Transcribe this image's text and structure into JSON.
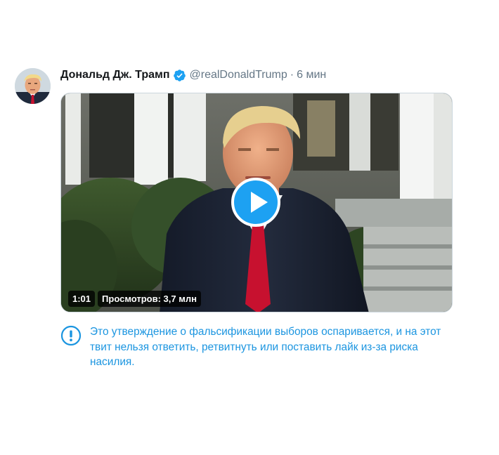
{
  "tweet": {
    "author_name": "Дональд Дж. Трамп",
    "handle": "@realDonaldTrump",
    "separator": "·",
    "time": "6 мин"
  },
  "video": {
    "duration": "1:01",
    "views": "Просмотров: 3,7 млн"
  },
  "notice": {
    "text": "Это утверждение о фальсификации выборов оспаривается, и на этот твит нельзя ответить, ретвитнуть или поставить лайк из-за риска насилия."
  },
  "colors": {
    "accent": "#1da1f2",
    "notice_text": "#1b95e0",
    "name": "#14171a",
    "muted": "#657786"
  },
  "icons": {
    "verified": "verified-badge-icon",
    "play": "play-icon",
    "notice": "exclamation-circle-icon"
  }
}
